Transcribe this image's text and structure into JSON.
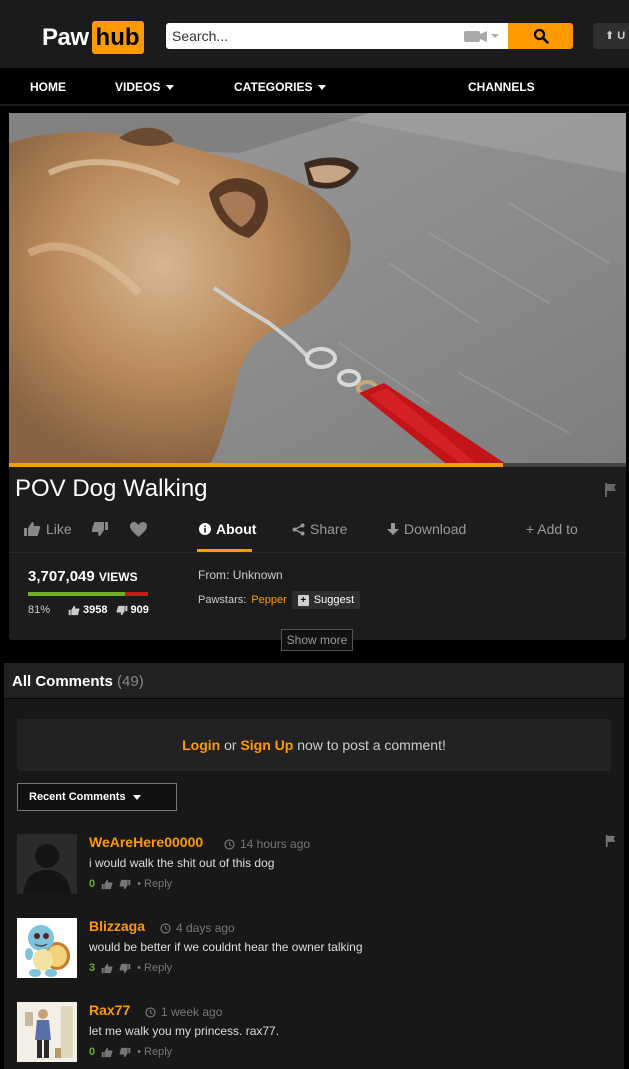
{
  "header": {
    "logo_part1": "Paw",
    "logo_part2": "hub",
    "search_placeholder": "Search...",
    "upload_label": "U",
    "accent_color": "#ff9900"
  },
  "nav": {
    "items": [
      {
        "label": "HOME",
        "dropdown": false
      },
      {
        "label": "VIDEOS",
        "dropdown": true
      },
      {
        "label": "CATEGORIES",
        "dropdown": true
      },
      {
        "label": "CHANNELS",
        "dropdown": false
      }
    ]
  },
  "video": {
    "title": "POV Dog Walking",
    "progress": 0.8,
    "actions": {
      "like": "Like",
      "about": "About",
      "share": "Share",
      "download": "Download",
      "add_to": "+ Add to"
    },
    "views_count": "3,707,049",
    "views_label": "VIEWS",
    "rating_percent": "81%",
    "rating_fraction": 0.81,
    "likes": "3958",
    "dislikes": "909",
    "from_label": "From:",
    "from_value": "Unknown",
    "pawstars_label": "Pawstars:",
    "pawstar": "Pepper",
    "suggest_label": "Suggest",
    "show_more": "Show more"
  },
  "comments": {
    "title": "All Comments",
    "count": "(49)",
    "login": "Login",
    "or": "or",
    "signup": "Sign Up",
    "login_suffix": "now to post a comment!",
    "sort_label": "Recent Comments",
    "reply_label": "• Reply",
    "items": [
      {
        "user": "WeAreHere00000",
        "time": "14 hours ago",
        "text": "i would walk the shit out of this dog",
        "score": "0"
      },
      {
        "user": "Blizzaga",
        "time": "4 days ago",
        "text": "would be better if we couldnt hear the owner talking",
        "score": "3"
      },
      {
        "user": "Rax77",
        "time": "1 week ago",
        "text": "let me walk you my princess. rax77.",
        "score": "0"
      }
    ]
  }
}
